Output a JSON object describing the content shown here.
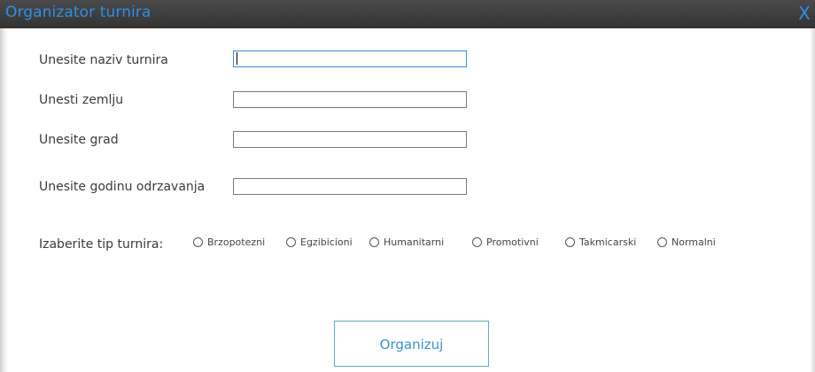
{
  "window": {
    "title": "Organizator turnira",
    "close_glyph": "X",
    "accent_color": "#2f8fe6"
  },
  "form": {
    "fields": [
      {
        "label": "Unesite naziv turnira",
        "value": "",
        "placeholder": ""
      },
      {
        "label": "Unesti zemlju",
        "value": "",
        "placeholder": ""
      },
      {
        "label": "Unesite grad",
        "value": "",
        "placeholder": ""
      },
      {
        "label": "Unesite godinu odrzavanja",
        "value": "",
        "placeholder": ""
      }
    ],
    "tournament_type": {
      "label": "Izaberite tip turnira:",
      "options": [
        "Brzopotezni",
        "Egzibicioni",
        "Humanitarni",
        "Promotivni",
        "Takmicarski",
        "Normalni"
      ],
      "selected": null
    },
    "submit_label": "Organizuj"
  }
}
